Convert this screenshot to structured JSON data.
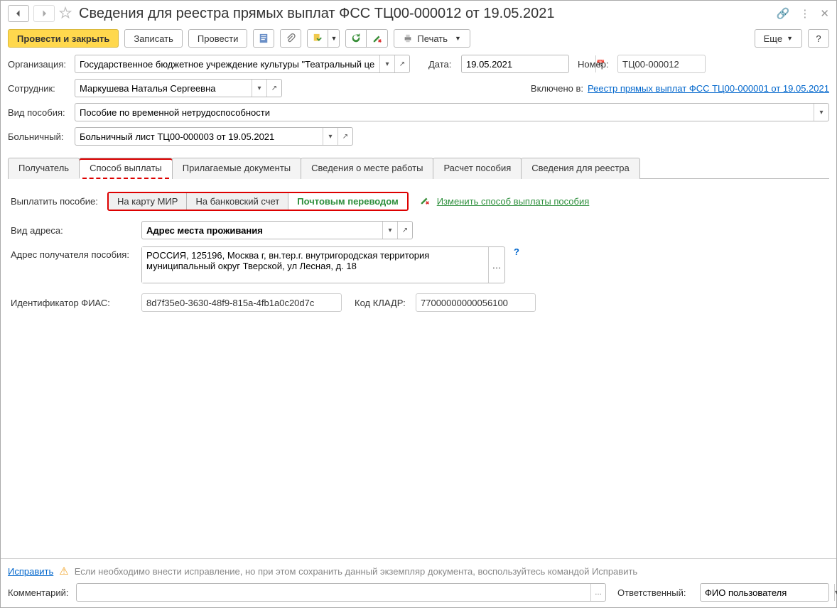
{
  "title": "Сведения для реестра прямых выплат ФСС ТЦ00-000012 от 19.05.2021",
  "toolbar": {
    "submit_close": "Провести и закрыть",
    "save": "Записать",
    "submit": "Провести",
    "print": "Печать",
    "more": "Еще"
  },
  "header": {
    "org_label": "Организация:",
    "org_value": "Государственное бюджетное учреждение культуры \"Театральный центр\"",
    "date_label": "Дата:",
    "date_value": "19.05.2021",
    "number_label": "Номер:",
    "number_value": "ТЦ00-000012",
    "employee_label": "Сотрудник:",
    "employee_value": "Маркушева Наталья Сергеевна",
    "included_label": "Включено в:",
    "included_link": "Реестр прямых выплат ФСС ТЦ00-000001 от 19.05.2021",
    "benefit_type_label": "Вид пособия:",
    "benefit_type_value": "Пособие по временной нетрудоспособности",
    "sicklist_label": "Больничный:",
    "sicklist_value": "Больничный лист ТЦ00-000003 от 19.05.2021"
  },
  "tabs": [
    "Получатель",
    "Способ выплаты",
    "Прилагаемые документы",
    "Сведения о месте работы",
    "Расчет пособия",
    "Сведения для реестра"
  ],
  "payment": {
    "pay_label": "Выплатить пособие:",
    "options": [
      "На карту МИР",
      "На банковский счет",
      "Почтовым переводом"
    ],
    "change_link": "Изменить способ выплаты пособия",
    "address_type_label": "Вид адреса:",
    "address_type_value": "Адрес места проживания",
    "recipient_addr_label": "Адрес получателя пособия:",
    "recipient_addr_value": "РОССИЯ, 125196, Москва г, вн.тер.г. внутригородская территория муниципальный округ Тверской, ул Лесная, д. 18",
    "fias_label": "Идентификатор ФИАС:",
    "fias_value": "8d7f35e0-3630-48f9-815a-4fb1a0c20d7c",
    "kladr_label": "Код КЛАДР:",
    "kladr_value": "77000000000056100"
  },
  "footer": {
    "fix_link": "Исправить",
    "fix_note": "Если необходимо внести исправление, но при этом сохранить данный экземпляр документа, воспользуйтесь командой Исправить",
    "comment_label": "Комментарий:",
    "comment_value": "",
    "responsible_label": "Ответственный:",
    "responsible_value": "ФИО пользователя"
  }
}
